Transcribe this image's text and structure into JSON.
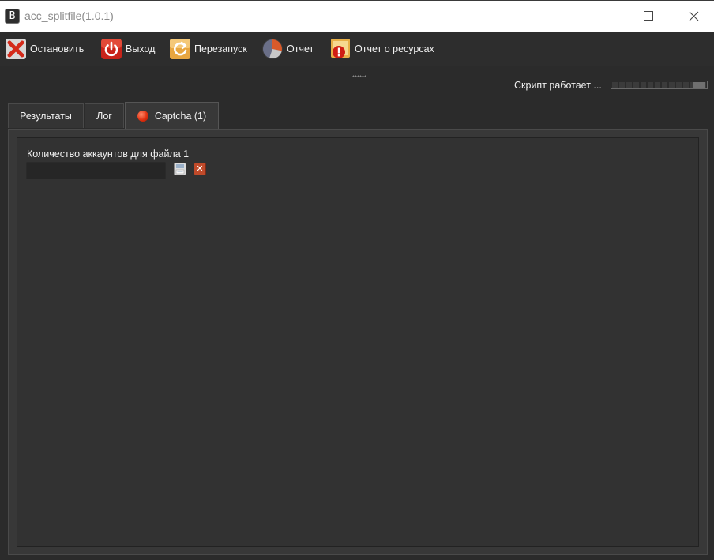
{
  "window": {
    "app_icon_letter": "B",
    "title": "acc_splitfile(1.0.1)"
  },
  "toolbar": {
    "stop_label": "Остановить",
    "exit_label": "Выход",
    "restart_label": "Перезапуск",
    "report_label": "Отчет",
    "resource_report_label": "Отчет о ресурсах"
  },
  "status": {
    "text": "Скрипт работает ..."
  },
  "tabs": [
    {
      "label": "Результаты",
      "active": false
    },
    {
      "label": "Лог",
      "active": false
    },
    {
      "label": "Captcha (1)",
      "active": true
    }
  ],
  "panel": {
    "field_label": "Количество аккаунтов для файла 1",
    "field_value": "",
    "clear_symbol": "✕"
  },
  "colors": {
    "background": "#2b2b2b",
    "panel": "#383838",
    "text": "#f0f0f0",
    "accent_red": "#c04a2a"
  },
  "icons": {
    "stop": "red-x-icon",
    "exit": "power-icon",
    "restart": "refresh-icon",
    "report": "pie-chart-icon",
    "resource_report": "warning-icon",
    "captcha": "red-dot-icon",
    "save": "save-icon",
    "clear": "close-icon"
  }
}
